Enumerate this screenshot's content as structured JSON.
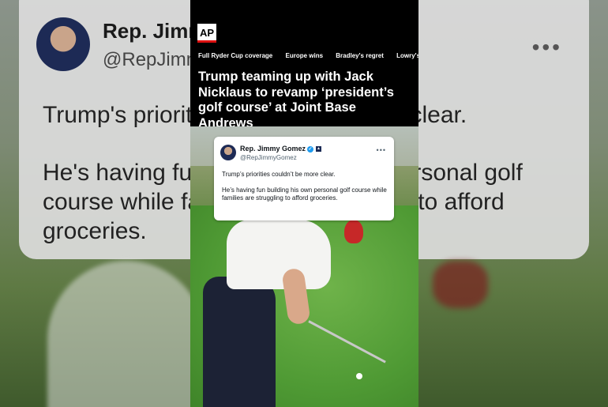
{
  "background": {
    "author_name": "Rep. Jimmy Gomez",
    "author_handle": "@RepJimmyGomez",
    "more_glyph": "•••",
    "text_line1": "Trump's priorities couldn't be more clear.",
    "text_line2": "He's having fun building his own personal golf course while families are struggling to afford groceries."
  },
  "header": {
    "logo": "AP",
    "nav": [
      "Full Ryder Cup coverage",
      "Europe wins",
      "Bradley's regret",
      "Lowry's clinching"
    ],
    "headline": "Trump teaming up with Jack Nicklaus to revamp ‘president’s golf course’ at Joint Base Andrews"
  },
  "tweet": {
    "name": "Rep. Jimmy Gomez",
    "verified_glyph": "✓",
    "flag_glyph": "▲",
    "handle": "@RepJimmyGomez",
    "more_glyph": "•••",
    "paragraph1": "Trump’s priorities couldn’t be more clear.",
    "paragraph2": "He’s having fun building his own personal golf course while families are struggling to afford groceries."
  },
  "icons": {
    "verified": "verified-badge-icon",
    "more": "more-options-icon"
  },
  "colors": {
    "ap_red": "#dd1111",
    "verified_blue": "#1d9bf0",
    "header_bg": "#000000"
  }
}
